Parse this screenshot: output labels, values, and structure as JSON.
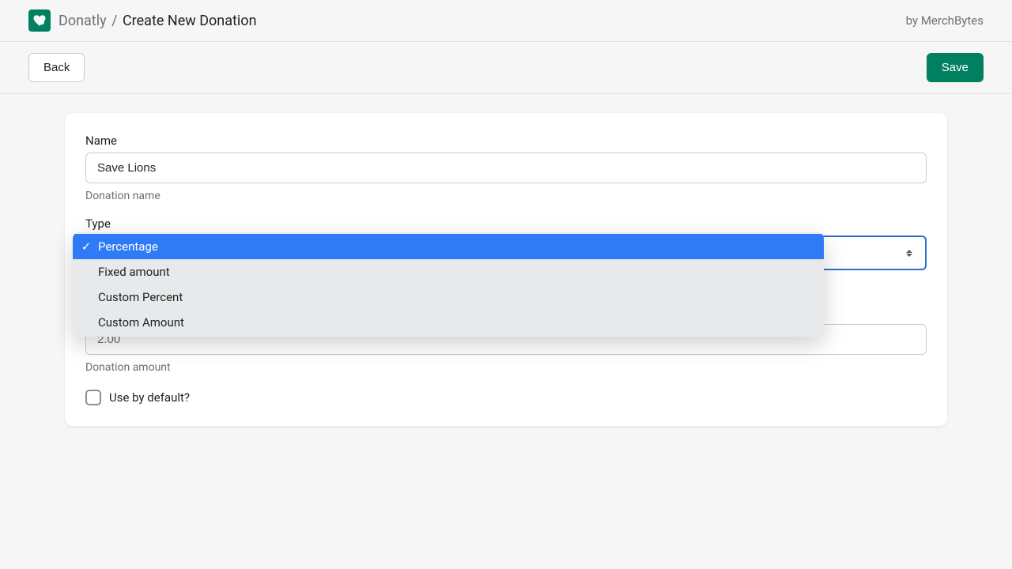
{
  "header": {
    "app_name": "Donatly",
    "separator": "/",
    "page_title": "Create New Donation",
    "attribution": "by MerchBytes"
  },
  "actions": {
    "back": "Back",
    "save": "Save"
  },
  "form": {
    "name": {
      "label": "Name",
      "value": "Save Lions",
      "helper": "Donation name"
    },
    "type": {
      "label": "Type",
      "options": {
        "opt0": "Percentage",
        "opt1": "Fixed amount",
        "opt2": "Custom Percent",
        "opt3": "Custom Amount"
      },
      "selected_check": "✓"
    },
    "amount": {
      "value": "2.00",
      "helper": "Donation amount"
    },
    "default": {
      "label": "Use by default?"
    }
  }
}
